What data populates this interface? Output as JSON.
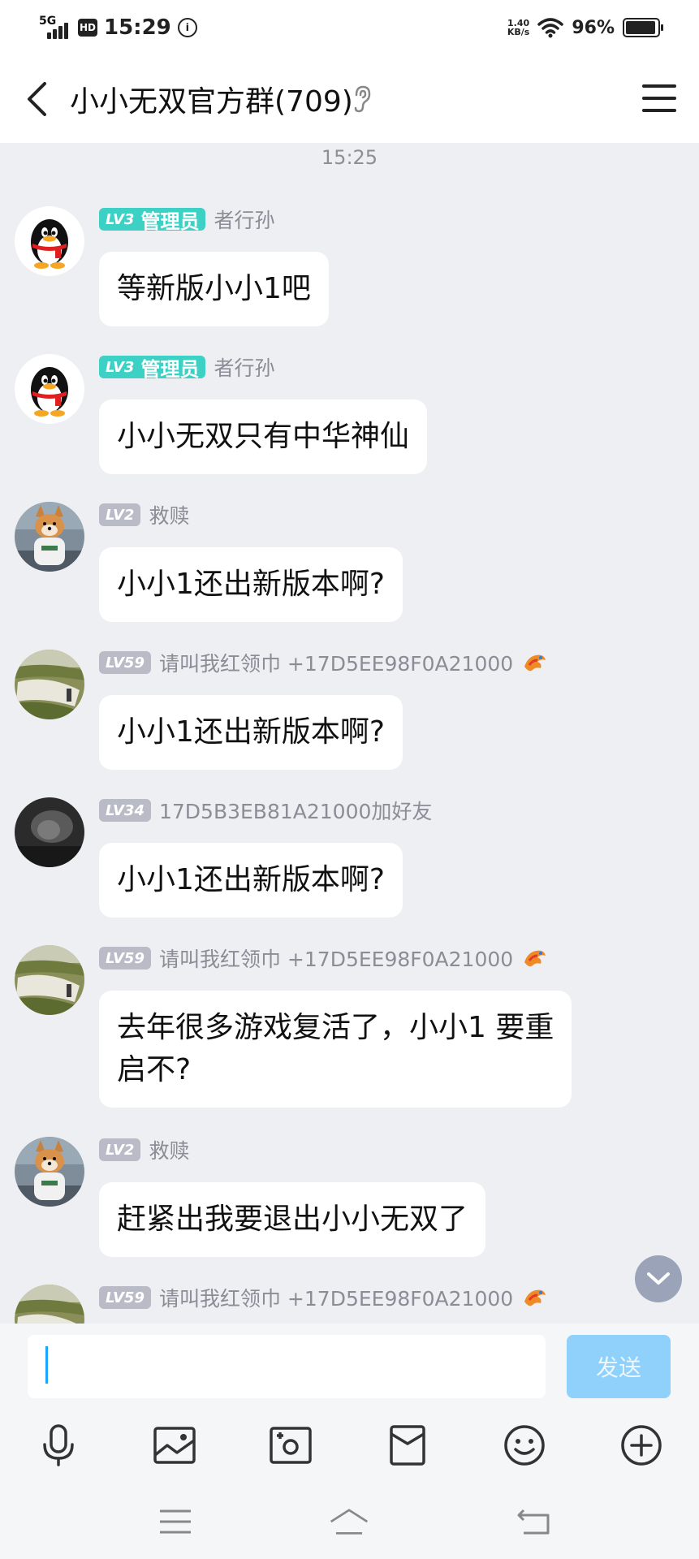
{
  "status_bar": {
    "network": "5G",
    "hd": "HD",
    "time": "15:29",
    "speed_value": "1.40",
    "speed_unit": "KB/s",
    "battery": "96%",
    "battery_level": 0.96
  },
  "header": {
    "title": "小小无双官方群(709)"
  },
  "chat": {
    "timestamp": "15:25",
    "messages": [
      {
        "level": "LV3",
        "role": "管理员",
        "sender": "者行孙",
        "text": "等新版小小1吧"
      },
      {
        "level": "LV3",
        "role": "管理员",
        "sender": "者行孙",
        "text": "小小无双只有中华神仙"
      },
      {
        "level": "LV2",
        "sender": "救赎",
        "text": "小小1还出新版本啊?"
      },
      {
        "level": "LV59",
        "sender": "请叫我红领巾 +17D5EE98F0A21000",
        "text": "小小1还出新版本啊?"
      },
      {
        "level": "LV34",
        "sender": "17D5B3EB81A21000加好友",
        "text": "小小1还出新版本啊?"
      },
      {
        "level": "LV59",
        "sender": "请叫我红领巾 +17D5EE98F0A21000",
        "text_line1": "去年很多游戏复活了，小小1 要重",
        "text_line2": "启不?"
      },
      {
        "level": "LV2",
        "sender": "救赎",
        "text": "赶紧出我要退出小小无双了"
      },
      {
        "level": "LV59",
        "sender": "请叫我红领巾 +17D5EE98F0A21000"
      }
    ]
  },
  "input": {
    "value": "",
    "send_label": "发送"
  },
  "toolbar": {
    "icons": [
      "microphone-icon",
      "image-icon",
      "camera-icon",
      "red-packet-icon",
      "emoji-icon",
      "plus-icon"
    ]
  },
  "colors": {
    "admin_badge": "#3cd1c4",
    "level_badge": "#b9bcc6",
    "send_button": "#8fd1fb",
    "chat_background": "#eeeff3"
  }
}
